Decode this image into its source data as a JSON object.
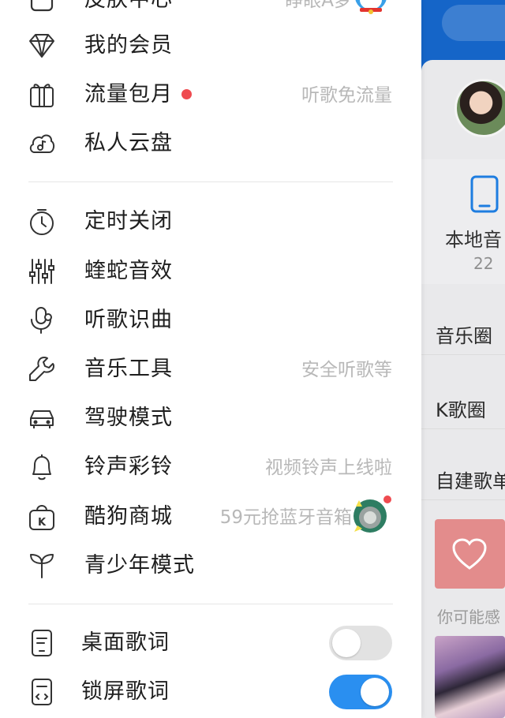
{
  "drawer": {
    "top_partial": {
      "label": "皮肤中心",
      "hint": "睁眼A梦"
    },
    "section1": [
      {
        "label": "我的会员",
        "icon": "diamond-icon"
      },
      {
        "label": "流量包月",
        "icon": "gift-icon",
        "hint": "听歌免流量",
        "red_dot": true
      },
      {
        "label": "私人云盘",
        "icon": "cloud-music-icon"
      }
    ],
    "section2": [
      {
        "label": "定时关闭",
        "icon": "timer-icon"
      },
      {
        "label": "蝰蛇音效",
        "icon": "equalizer-icon"
      },
      {
        "label": "听歌识曲",
        "icon": "song-recognition-icon"
      },
      {
        "label": "音乐工具",
        "icon": "wrench-icon",
        "hint": "安全听歌等"
      },
      {
        "label": "驾驶模式",
        "icon": "car-icon"
      },
      {
        "label": "铃声彩铃",
        "icon": "bell-icon",
        "hint": "视频铃声上线啦"
      },
      {
        "label": "酷狗商城",
        "icon": "shopping-bag-icon",
        "hint": "59元抢蓝牙音箱",
        "badge_dot": true
      },
      {
        "label": "青少年模式",
        "icon": "sprout-icon"
      }
    ],
    "section3": [
      {
        "label": "桌面歌词",
        "icon": "desktop-lyrics-icon",
        "toggle_on": false
      },
      {
        "label": "锁屏歌词",
        "icon": "lockscreen-lyrics-icon",
        "toggle_on": true
      }
    ],
    "colors": {
      "accent": "#2a8ff0",
      "red_dot": "#ef4b50",
      "hint_text": "#b8b8b8"
    }
  },
  "main": {
    "local_label": "本地音",
    "local_count": "22",
    "rows": [
      "音乐圈",
      "K歌圈",
      "自建歌单"
    ],
    "recommend_text": "你可能感",
    "colors": {
      "header": "#1565c8",
      "heart_tile": "#e38c8c"
    }
  }
}
